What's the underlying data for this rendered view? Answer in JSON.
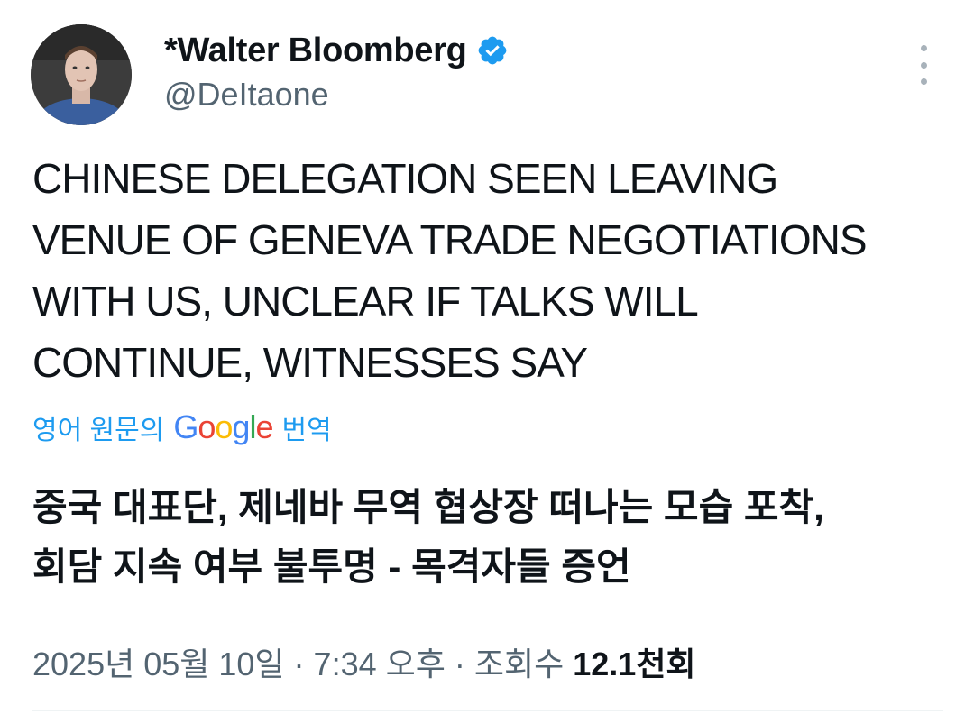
{
  "author": {
    "display_name": "*Walter Bloomberg",
    "handle": "@DeItaone",
    "verified_color": "#1d9bf0",
    "avatar_icon": "profile-photo"
  },
  "tweet": {
    "lines": [
      "CHINESE DELEGATION SEEN LEAVING",
      "VENUE OF GENEVA TRADE NEGOTIATIONS",
      "WITH US, UNCLEAR IF TALKS WILL",
      "CONTINUE, WITNESSES SAY"
    ]
  },
  "translation": {
    "prefix": "영어 원문의",
    "google": "Google",
    "suffix": "번역",
    "lines": [
      "중국 대표단, 제네바 무역 협상장 떠나는 모습 포착,",
      "회담 지속 여부 불투명 - 목격자들 증언"
    ]
  },
  "meta": {
    "date": "2025년 05월 10일",
    "separator": " · ",
    "time": "7:34 오후",
    "views_label": "조회수",
    "views_count": "12.1천회"
  },
  "colors": {
    "accent": "#1d9bf0",
    "text": "#0f1419",
    "secondary": "#536471"
  }
}
